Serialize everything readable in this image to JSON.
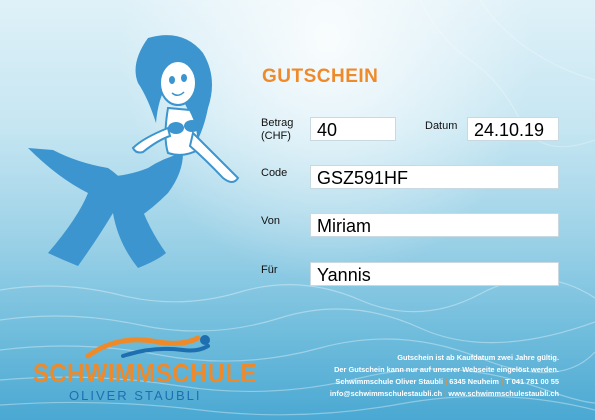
{
  "voucher": {
    "title": "GUTSCHEIN",
    "betrag_label_1": "Betrag",
    "betrag_label_2": "(CHF)",
    "betrag_value": "40",
    "datum_label": "Datum",
    "datum_value": "24.10.19",
    "code_label": "Code",
    "code_value": "GSZ591HF",
    "von_label": "Von",
    "von_value": "Miriam",
    "fuer_label": "Für",
    "fuer_value": "Yannis"
  },
  "logo": {
    "main": "SCHWIMMSCHULE",
    "sub": "OLIVER STAUBLI"
  },
  "footer": {
    "line1": "Gutschein ist ab Kaufdatum zwei Jahre gültig.",
    "line2": "Der Gutschein kann nur auf unserer Webseite eingelöst werden.",
    "company": "Schwimmschule Oliver Staubli",
    "address": "6345 Neuheim",
    "phone": "T 041 781 00 55",
    "email": "info@schwimmschulestaubli.ch",
    "website": "www.schwimmschulestaubli.ch",
    "separator": "|"
  },
  "colors": {
    "accent": "#ef8a2a",
    "brand_blue": "#1e6fb0",
    "mermaid_blue": "#3c95cf"
  },
  "icons": {
    "mermaid": "mermaid-illustration",
    "logo_swimmer": "swimmer-wave-icon"
  }
}
